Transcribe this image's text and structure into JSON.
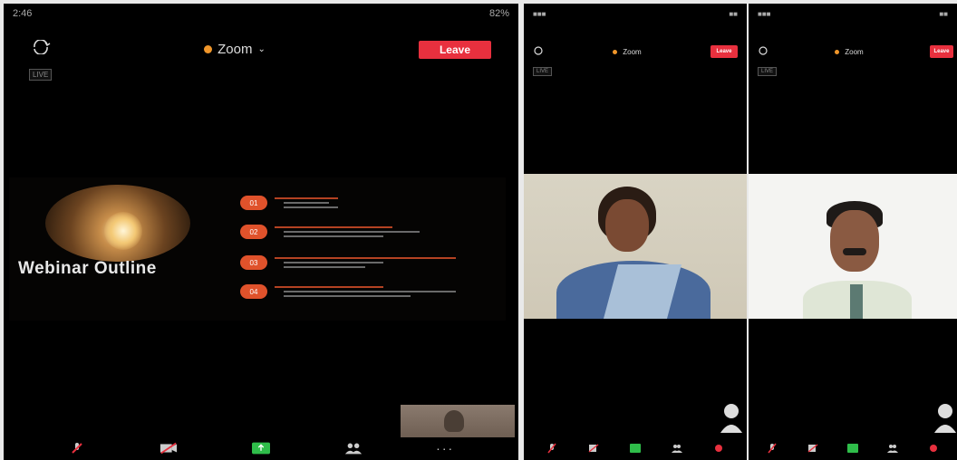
{
  "left_phone": {
    "status_time": "2:46",
    "status_right": "82%",
    "app_title": "Zoom",
    "leave_label": "Leave",
    "live_label": "LIVE",
    "slide": {
      "title": "Webinar Outline",
      "items": [
        {
          "num": "01"
        },
        {
          "num": "02"
        },
        {
          "num": "03"
        },
        {
          "num": "04"
        }
      ]
    },
    "toolbar": [
      "unmute",
      "start-video",
      "share",
      "participants",
      "more"
    ]
  },
  "right_phone_a": {
    "app_title": "Zoom",
    "leave_label": "Leave",
    "live_label": "LIVE"
  },
  "right_phone_b": {
    "app_title": "Zoom",
    "leave_label": "Leave",
    "live_label": "LIVE"
  },
  "colors": {
    "leave_red": "#e8303e",
    "zoom_dot": "#f0962a",
    "share_green": "#2fbd4a",
    "accent_orange": "#e0522b"
  }
}
